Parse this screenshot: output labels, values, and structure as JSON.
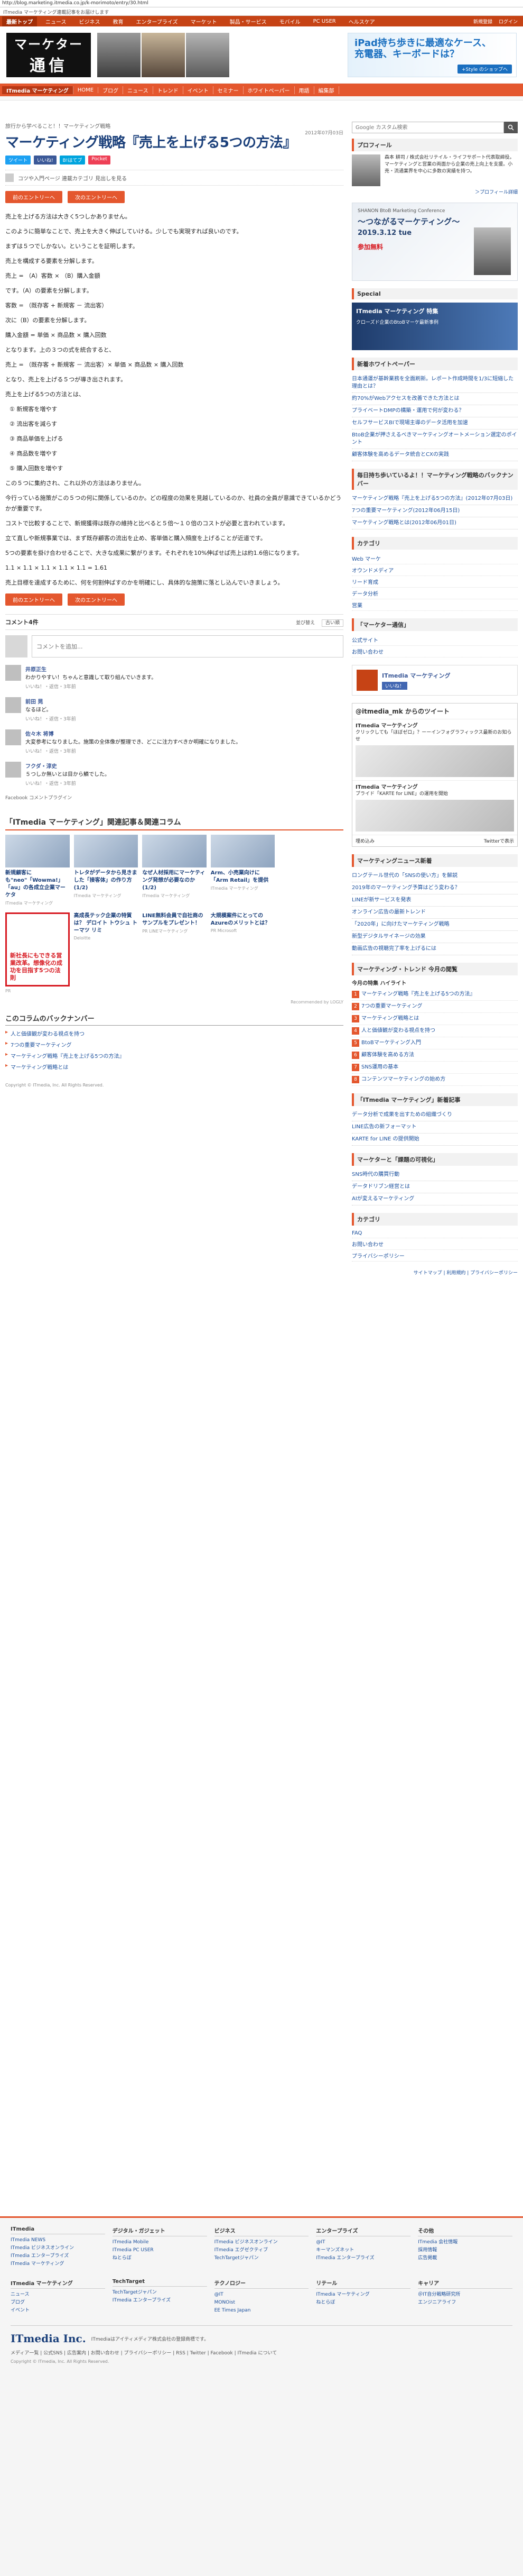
{
  "browser": {
    "url": "http://blog.marketing.itmedia.co.jp/k-morimoto/entry/30.html",
    "pretitle": "ITmedia マーケティング連載記事をお届けします"
  },
  "gnav": {
    "home": "最新トップ",
    "items": [
      "ニュース",
      "ビジネス",
      "教育",
      "エンタープライズ",
      "マーケット",
      "製品・サービス",
      "モバイル",
      "PC USER",
      "ヘルスケア"
    ],
    "right": [
      "新規登録",
      "ログイン"
    ]
  },
  "header": {
    "logo_line1": "マーケター",
    "logo_line2": "通信",
    "ad_line1": "iPad持ち歩きに最適なケース、",
    "ad_line2": "充電器、キーボードは？",
    "ad_button": "+Style のショップへ"
  },
  "channel_bar": {
    "items": [
      "ITmedia マーケティング",
      "HOME",
      "ブログ",
      "ニュース",
      "トレンド",
      "イベント",
      "セミナー",
      "ホワイトペーパー",
      "用語",
      "編集部"
    ],
    "active_index": 0
  },
  "article": {
    "breadcrumb": "旅行から学べること！！マーケティング戦略",
    "date": "2012年07月03日",
    "title": "マーケティング戦略『売上を上げる5つの方法』",
    "share": [
      "ツイート",
      "いいね!",
      "B!はてブ",
      "Pocket"
    ],
    "author_note": "コツや入門ページ 連載カテゴリ 見出しを見る",
    "prev_label": "前のエントリーへ",
    "next_label": "次のエントリーへ",
    "paragraphs": [
      "売上を上げる方法は大きく5つしかありません。",
      "このように簡単なことで、売上を大きく伸ばしていける。少しでも実現すれば良いのです。",
      "まずは５つでしかない。ということを証明します。",
      "売上を構成する要素を分解します。",
      "売上 = （A）客数 × （B）購入金額",
      "です。（A）の要素を分解します。",
      "客数 = （既存客 + 新規客 － 流出客）",
      "次に（B）の要素を分解します。",
      "購入金額 = 単価 × 商品数 × 購入回数",
      "となります。上の３つの式を統合すると、",
      "売上 = （既存客 + 新規客 － 流出客）× 単価 × 商品数 × 購入回数",
      "となり、売上を上げる５つが導き出されます。",
      "売上を上げる5つの方法とは、",
      "① 新規客を増やす",
      "② 流出客を減らす",
      "③ 商品単価を上げる",
      "④ 商品数を増やす",
      "⑤ 購入回数を増やす",
      "この５つに集約され、これ以外の方法はありません。",
      "今行っている施策がこの５つの何に関係しているのか。どの程度の効果を見越しているのか、社員の全員が意識できているかどうかが重要です。",
      "コストで比較することで、新規獲得は既存の維持と比べると５倍〜１０倍のコストが必要と言われています。",
      "立て直しや新規事業では、まず既存顧客の流出を止め、客単価と購入頻度を上げることが近道です。",
      "5つの要素を掛け合わせることで、大きな成果に繋がります。それぞれを10%伸ばせば売上は約1.6倍になります。",
      "1.1 × 1.1 × 1.1 × 1.1 × 1.1 = 1.61",
      "売上目標を達成するために、何を何割伸ばすのかを明確にし、具体的な施策に落とし込んでいきましょう。"
    ]
  },
  "comments": {
    "count_label": "コメント4件",
    "sort_label": "並び替え",
    "sort_value": "古い順",
    "placeholder": "コメントを追加...",
    "items": [
      {
        "name": "井原正生",
        "text": "わかりやすい！ちゃんと意識して取り組んでいきます。",
        "meta": "いいね！・返信・3年前"
      },
      {
        "name": "前田 晃",
        "text": "なるほど。",
        "meta": "いいね！・返信・3年前"
      },
      {
        "name": "佐々木 将博",
        "text": "大変参考になりました。施策の全体像が整理でき、どこに注力すべきか明確になりました。",
        "meta": "いいね！・返信・3年前"
      },
      {
        "name": "フクダ・淳史",
        "text": "５つしか無いとは目から鱗でした。",
        "meta": "いいね！・返信・3年前"
      }
    ],
    "plugin_label": "Facebook コメントプラグイン"
  },
  "related": {
    "title": "「ITmedia マーケティング」関連記事＆関連コラム",
    "row1": [
      {
        "text": "新規顧客にも\"neo\"「Wowma!」「au」の各成立企業マーケタ",
        "src": "ITmedia マーケティング"
      },
      {
        "text": "トレタがデータから見きました「接客体」の作り方 (1/2)",
        "src": "ITmedia マーケティング"
      },
      {
        "text": "なぜ人材採用にマーケティング発想が必要なのか (1/2)",
        "src": "ITmedia マーケティング"
      },
      {
        "text": "Arm、小売業向けに「Arm Retail」を提供",
        "src": "ITmedia マーケティング"
      },
      {
        "text": "",
        "src": ""
      }
    ],
    "row2": [
      {
        "text": "新社長にもできる営業改革。想像化の成功を目指す5つの法則",
        "src": "PR",
        "ad": true
      },
      {
        "text": "高成長テック企業の特質は？ デロイト トウシュ トーマツ リミ",
        "src": "Deloitte"
      },
      {
        "text": "LINE無料会員で自社商のサンプルをプレゼント！",
        "src": "PR LINEマーケティング"
      },
      {
        "text": "大規模案件にとってのAzureのメリットとは？",
        "src": "PR Microsoft"
      },
      {
        "text": "",
        "src": ""
      }
    ],
    "recommend": "Recommended by LOGLY"
  },
  "backnumber": {
    "title": "このコラムのバックナンバー",
    "items": [
      "人と価値観が変わる視点を持つ",
      "7つの重要マーケティング",
      "マーケティング戦略『売上を上げる5つの方法』",
      "マーケティング戦略とは"
    ],
    "copyright": "Copyright © ITmedia, Inc. All Rights Reserved."
  },
  "sidebar": {
    "search_placeholder": "Google カスタム検索",
    "profile_title": "プロフィール",
    "profile_text": "森本 耕司 / 株式会社リテイル・ライフサポート代表取締役。マーケティングと営業の両面から企業の売上向上を支援。小売・流通業界を中心に多数の実績を持つ。",
    "profile_more": "＞プロフィール詳細",
    "banner_title": "SHANON BtoB Marketing Conference",
    "banner_head": "〜つながるマーケティング〜",
    "banner_date": "2019.3.12 tue",
    "banner_free": "参加無料",
    "special_title": "Special",
    "special_text": "ITmedia マーケティング 特集",
    "special_sub": "クローズド企業のBtoBマーケ最新事例",
    "whitepaper_title": "新着ホワイトペーパー",
    "whitepapers": [
      "日本通運が基幹業務を全面刷新。レポート作成時間を1/3に短縮した理由とは？",
      "約70%がWebアクセスを改善できた方法とは",
      "プライベートDMPの構築・運用で何が変わる？",
      "セルフサービスBIで現場主導のデータ活用を加速",
      "BtoB企業が押さえるべきマーケティングオートメーション選定のポイント",
      "顧客体験を高めるデータ統合とCXの実践"
    ],
    "hot_title": "毎日持ち歩いているよ！！マーケティング戦略のバックナンバー",
    "hot_items": [
      "マーケティング戦略『売上を上げる5つの方法』(2012年07月03日)",
      "7つの重要マーケティング(2012年06月15日)",
      "マーケティング戦略とは(2012年06月01日)"
    ],
    "category_title": "カテゴリ",
    "categories": [
      "Web マーケ",
      "オウンドメディア",
      "リード育成",
      "データ分析",
      "営業"
    ],
    "iab_title": "「マーケター通信」",
    "iab_links": [
      "公式サイト",
      "お問い合わせ"
    ],
    "fb_page": "ITmedia マーケティング",
    "fb_like": "いいね！",
    "tweets_label": "@itmedia_mk からのツイート",
    "tweets": [
      {
        "name": "ITmedia マーケティング",
        "text": "クリックしても「ほぼゼロ」？ーーインフォグラフィックス最新のお知らせ"
      },
      {
        "name": "ITmedia マーケティング",
        "text": "プライド「KARTE for LINE」の運用を開始"
      }
    ],
    "embed_label": "埋め込み",
    "twitter_link": "Twitterで表示",
    "news_title": "マーケティングニュース新着",
    "news_items": [
      "ロングテール世代の「SNSの使い方」を解説",
      "2019年のマーケティング予算はどう変わる？",
      "LINEが新サービスを発表",
      "オンライン広告の最新トレンド",
      "「2020年」に向けたマーケティング戦略",
      "新型デジタルサイネージの効果",
      "動画広告の視聴完了率を上げるには"
    ],
    "rank_title": "マーケティング・トレンド 今月の閲覧",
    "rank_label": "今月の特集 ハイライト",
    "rank_items": [
      "マーケティング戦略『売上を上げる5つの方法』",
      "7つの重要マーケティング",
      "マーケティング戦略とは",
      "人と価値観が変わる視点を持つ",
      "BtoBマーケティング入門",
      "顧客体験を高める方法",
      "SNS運用の基本",
      "コンテンツマーケティングの始め方"
    ],
    "itm_title": "「ITmedia マーケティング」新着記事",
    "itm_items": [
      "データ分析で成果を出すための組織づくり",
      "LINE広告の新フォーマット",
      "KARTE for LINE の提供開始"
    ],
    "extra_title": "マーケターと「課題の可視化」",
    "extra_items": [
      "SNS時代の購買行動",
      "データドリブン経営とは",
      "AIが変えるマーケティング"
    ],
    "misc_title": "カテゴリ",
    "misc_items": [
      "FAQ",
      "お問い合わせ",
      "プライバシーポリシー"
    ],
    "footer_links": "サイトマップ | 利用規約 | プライバシーポリシー"
  },
  "footer": {
    "cols": [
      {
        "title": "ITmedia",
        "items": [
          "ITmedia NEWS",
          "ITmedia ビジネスオンライン",
          "ITmedia エンタープライズ",
          "ITmedia マーケティング"
        ]
      },
      {
        "title": "デジタル・ガジェット",
        "items": [
          "ITmedia Mobile",
          "ITmedia PC USER",
          "ねとらぼ"
        ]
      },
      {
        "title": "ビジネス",
        "items": [
          "ITmedia ビジネスオンライン",
          "ITmedia エグゼクティブ",
          "TechTargetジャパン"
        ]
      },
      {
        "title": "エンタープライズ",
        "items": [
          "@IT",
          "キーマンズネット",
          "ITmedia エンタープライズ"
        ]
      },
      {
        "title": "その他",
        "items": [
          "ITmedia 会社情報",
          "採用情報",
          "広告掲載"
        ]
      }
    ],
    "cols2": [
      {
        "title": "ITmedia マーケティング",
        "items": [
          "ニュース",
          "ブログ",
          "イベント"
        ]
      },
      {
        "title": "TechTarget",
        "items": [
          "TechTargetジャパン",
          "ITmedia エンタープライズ"
        ]
      },
      {
        "title": "テクノロジー",
        "items": [
          "@IT",
          "MONOist",
          "EE Times Japan"
        ]
      },
      {
        "title": "リテール",
        "items": [
          "ITmedia マーケティング",
          "ねとらぼ"
        ]
      },
      {
        "title": "キャリア",
        "items": [
          "＠IT自分戦略研究所",
          "エンジニアライフ"
        ]
      }
    ],
    "logo": "ITmedia Inc.",
    "logo_desc": "ITmediaはアイティメディア株式会社の登録商標です。",
    "bottom_links": "メディア一覧 | 公式SNS | 広告案内 | お問い合わせ | プライバシーポリシー | RSS | Twitter | Facebook | ITmedia について",
    "copyright": "Copyright © ITmedia, Inc. All Rights Reserved."
  },
  "colors": {
    "accent": "#e4572e",
    "gnav": "#c64315",
    "title": "#1a3f7a",
    "link": "#1a4f9c"
  }
}
